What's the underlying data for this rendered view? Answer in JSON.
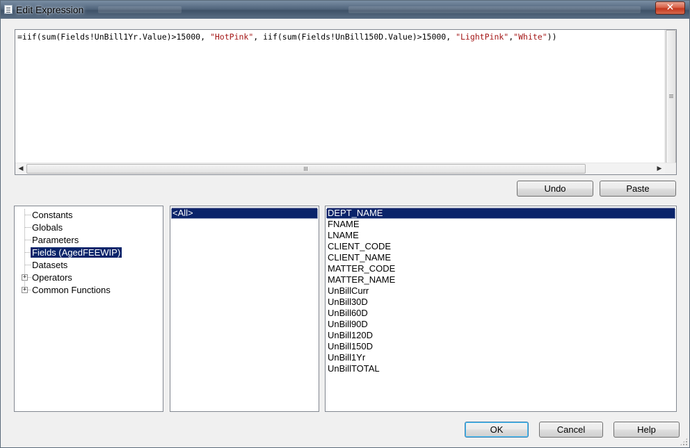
{
  "window": {
    "title": "Edit Expression",
    "close_glyph": "✕"
  },
  "editor": {
    "parts": [
      {
        "text": "=iif(sum(Fields!UnBill1Yr.Value)>15000, ",
        "kind": "plain"
      },
      {
        "text": "\"HotPink\"",
        "kind": "string"
      },
      {
        "text": ", iif(sum(Fields!UnBill150D.Value)>15000, ",
        "kind": "plain"
      },
      {
        "text": "\"LightPink\"",
        "kind": "string"
      },
      {
        "text": ",",
        "kind": "plain"
      },
      {
        "text": "\"White\"",
        "kind": "string"
      },
      {
        "text": "))",
        "kind": "plain"
      }
    ],
    "string_color": "#a31515"
  },
  "actions": {
    "undo_label": "Undo",
    "paste_label": "Paste"
  },
  "categories": {
    "items": [
      {
        "label": "Constants",
        "expandable": false
      },
      {
        "label": "Globals",
        "expandable": false
      },
      {
        "label": "Parameters",
        "expandable": false
      },
      {
        "label": "Fields (AgedFEEWIP)",
        "expandable": false,
        "selected": true
      },
      {
        "label": "Datasets",
        "expandable": false
      },
      {
        "label": "Operators",
        "expandable": true
      },
      {
        "label": "Common Functions",
        "expandable": true
      }
    ]
  },
  "subcategories": {
    "items": [
      "<All>"
    ],
    "selected": 0
  },
  "fields": {
    "items": [
      "DEPT_NAME",
      "FNAME",
      "LNAME",
      "CLIENT_CODE",
      "CLIENT_NAME",
      "MATTER_CODE",
      "MATTER_NAME",
      "UnBillCurr",
      "UnBill30D",
      "UnBill60D",
      "UnBill90D",
      "UnBill120D",
      "UnBill150D",
      "UnBill1Yr",
      "UnBillTOTAL"
    ],
    "selected": 0
  },
  "footer": {
    "ok_label": "OK",
    "cancel_label": "Cancel",
    "help_label": "Help"
  },
  "colors": {
    "selection": "#0a246a",
    "dialog_bg": "#f0f0f0"
  }
}
